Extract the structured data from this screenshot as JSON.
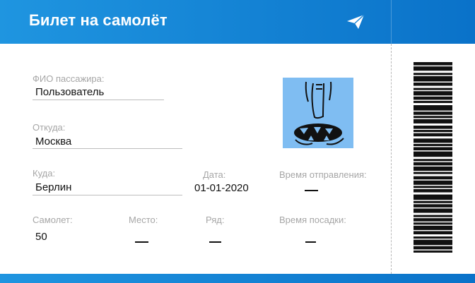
{
  "header": {
    "title": "Билет на самолёт",
    "icon": "paper-plane-icon"
  },
  "fields": {
    "passenger_label": "ФИО пассажира:",
    "passenger_value": "Пользователь",
    "from_label": "Откуда:",
    "from_value": "Москва",
    "to_label": "Куда:",
    "to_value": "Берлин",
    "date_label": "Дата:",
    "date_value": "01-01-2020",
    "departure_label": "Время отправления:",
    "plane_label": "Самолет:",
    "plane_value": "50",
    "seat_label": "Место:",
    "row_label": "Ряд:",
    "boarding_label": "Время посадки:"
  },
  "colors": {
    "header_start": "#1f95e0",
    "header_end": "#0a72c9",
    "avatar_bg": "#7fbdf2"
  },
  "barcode": {
    "bars": [
      3,
      1,
      4,
      2,
      2,
      1,
      5,
      1,
      3,
      2,
      2,
      1,
      4,
      1,
      3,
      1,
      2,
      2,
      5,
      1,
      3,
      1,
      2,
      1,
      4,
      2,
      3,
      1,
      2,
      1,
      3,
      2,
      4,
      1,
      2,
      1,
      3,
      1,
      5,
      2,
      2,
      1,
      3,
      1,
      4,
      1,
      2,
      2,
      3,
      1,
      4,
      1,
      2,
      1,
      3,
      2,
      5,
      1,
      2,
      1,
      3,
      1,
      4,
      2,
      2,
      1,
      3,
      1,
      2,
      1,
      4,
      1,
      3,
      2,
      2,
      1,
      5,
      1,
      3,
      1,
      2,
      2
    ]
  }
}
